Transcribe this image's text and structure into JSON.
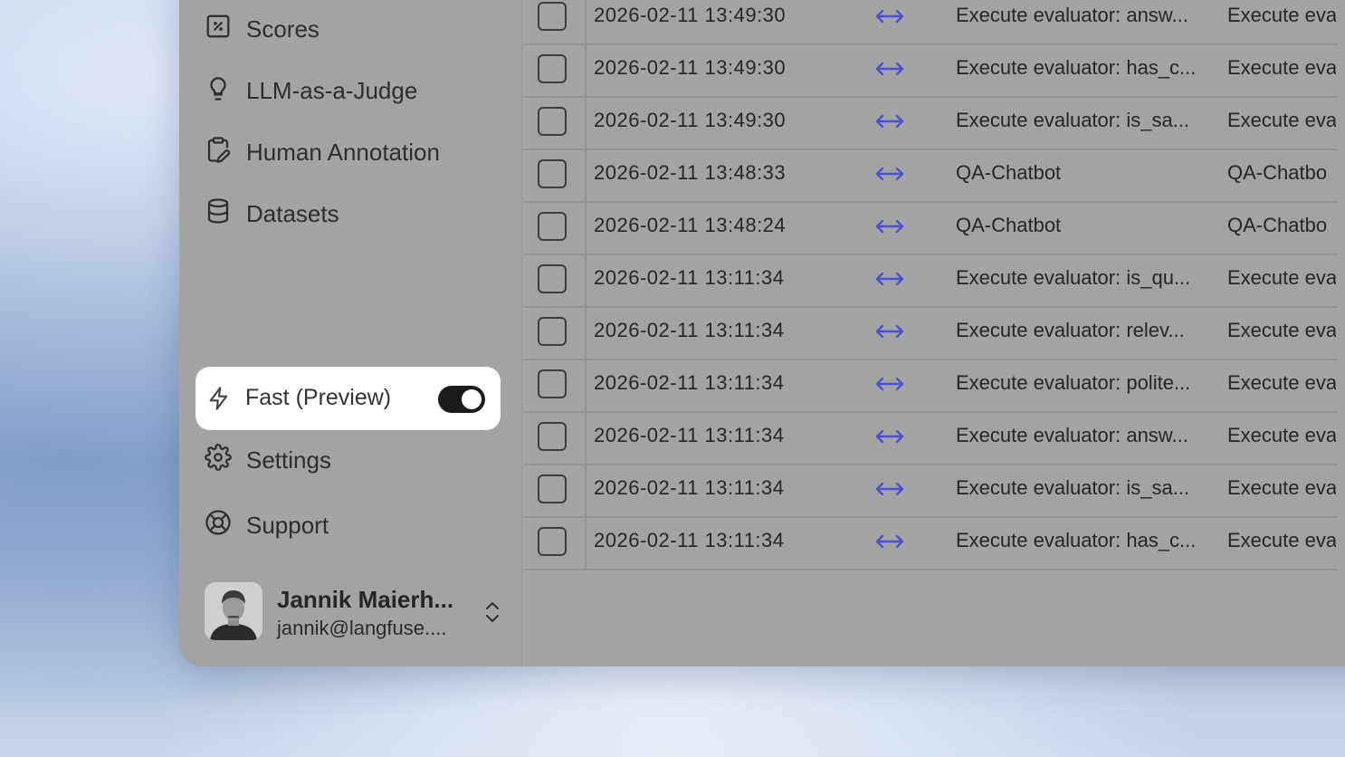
{
  "sidebar": {
    "nav": [
      {
        "label": "Scores",
        "icon": "percent-square-icon"
      },
      {
        "label": "LLM-as-a-Judge",
        "icon": "lightbulb-icon"
      },
      {
        "label": "Human Annotation",
        "icon": "clipboard-pen-icon"
      },
      {
        "label": "Datasets",
        "icon": "database-icon"
      }
    ],
    "fast_preview": {
      "label": "Fast (Preview)",
      "enabled": true
    },
    "settings_label": "Settings",
    "support_label": "Support",
    "user": {
      "name": "Jannik Maierh...",
      "email": "jannik@langfuse...."
    }
  },
  "traces": {
    "rows": [
      {
        "timestamp": "2026-02-11 13:49:30",
        "name": "Execute evaluator: answ...",
        "name2": "Execute eva"
      },
      {
        "timestamp": "2026-02-11 13:49:30",
        "name": "Execute evaluator: has_c...",
        "name2": "Execute eva"
      },
      {
        "timestamp": "2026-02-11 13:49:30",
        "name": "Execute evaluator: is_sa...",
        "name2": "Execute eva"
      },
      {
        "timestamp": "2026-02-11 13:48:33",
        "name": "QA-Chatbot",
        "name2": "QA-Chatbo"
      },
      {
        "timestamp": "2026-02-11 13:48:24",
        "name": "QA-Chatbot",
        "name2": "QA-Chatbo"
      },
      {
        "timestamp": "2026-02-11 13:11:34",
        "name": "Execute evaluator: is_qu...",
        "name2": "Execute eva"
      },
      {
        "timestamp": "2026-02-11 13:11:34",
        "name": "Execute evaluator: relev...",
        "name2": "Execute eva"
      },
      {
        "timestamp": "2026-02-11 13:11:34",
        "name": "Execute evaluator: polite...",
        "name2": "Execute eva"
      },
      {
        "timestamp": "2026-02-11 13:11:34",
        "name": "Execute evaluator: answ...",
        "name2": "Execute eva"
      },
      {
        "timestamp": "2026-02-11 13:11:34",
        "name": "Execute evaluator: is_sa...",
        "name2": "Execute eva"
      },
      {
        "timestamp": "2026-02-11 13:11:34",
        "name": "Execute evaluator: has_c...",
        "name2": "Execute eva"
      }
    ]
  },
  "colors": {
    "accent_arrow": "#4a4fd0"
  }
}
